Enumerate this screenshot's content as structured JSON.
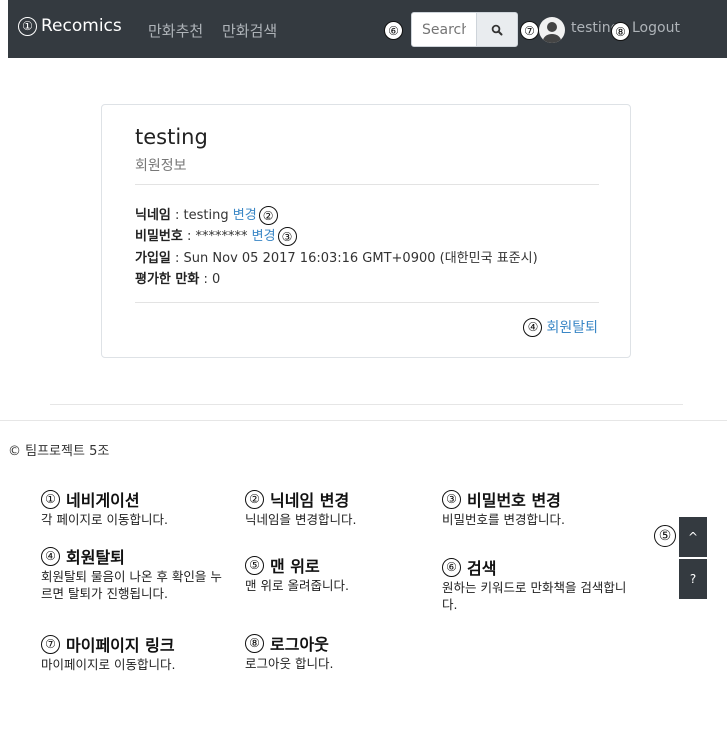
{
  "nav": {
    "brand": "Recomics",
    "brand_marker": "①",
    "links": [
      "만화추천",
      "만화검색"
    ],
    "search_marker": "⑥",
    "search_placeholder": "Search",
    "search_icon": "search-icon",
    "user_marker": "⑦",
    "username": "testing",
    "logout_marker": "⑧",
    "logout": "Logout"
  },
  "profile": {
    "name": "testing",
    "subtitle": "회원정보",
    "nickname_label": "닉네임",
    "nickname_value": " : testing ",
    "nickname_change": "변경",
    "nickname_marker": "②",
    "password_label": "비밀번호",
    "password_value": " : ******** ",
    "password_change": "변경",
    "password_marker": "③",
    "joined_label": "가입일",
    "joined_value": " : Sun Nov 05 2017 16:03:16 GMT+0900 (대한민국 표준시)",
    "rated_label": "평가한 만화",
    "rated_value": " : 0",
    "withdraw_marker": "④",
    "withdraw": "회원탈퇴"
  },
  "footer": {
    "copyright": "© 팀프로젝트 5조"
  },
  "help": [
    {
      "num": "①",
      "title": "네비게이션",
      "desc": "각 페이지로 이동합니다."
    },
    {
      "num": "②",
      "title": "닉네임 변경",
      "desc": "닉네임을 변경합니다."
    },
    {
      "num": "③",
      "title": "비밀번호 변경",
      "desc": "비밀번호를 변경합니다."
    },
    {
      "num": "④",
      "title": "회원탈퇴",
      "desc": "회원탈퇴 물음이 나온 후 확인을 누르면 탈퇴가 진행됩니다."
    },
    {
      "num": "⑤",
      "title": "맨 위로",
      "desc": "맨 위로 올려줍니다."
    },
    {
      "num": "⑥",
      "title": "검색",
      "desc": "원하는 키워드로 만화책을 검색합니다."
    },
    {
      "num": "⑦",
      "title": "마이페이지 링크",
      "desc": "마이페이지로 이동합니다."
    },
    {
      "num": "⑧",
      "title": "로그아웃",
      "desc": "로그아웃 합니다."
    }
  ],
  "floating": {
    "top_marker": "⑤",
    "top_label": "^",
    "help_label": "?"
  }
}
